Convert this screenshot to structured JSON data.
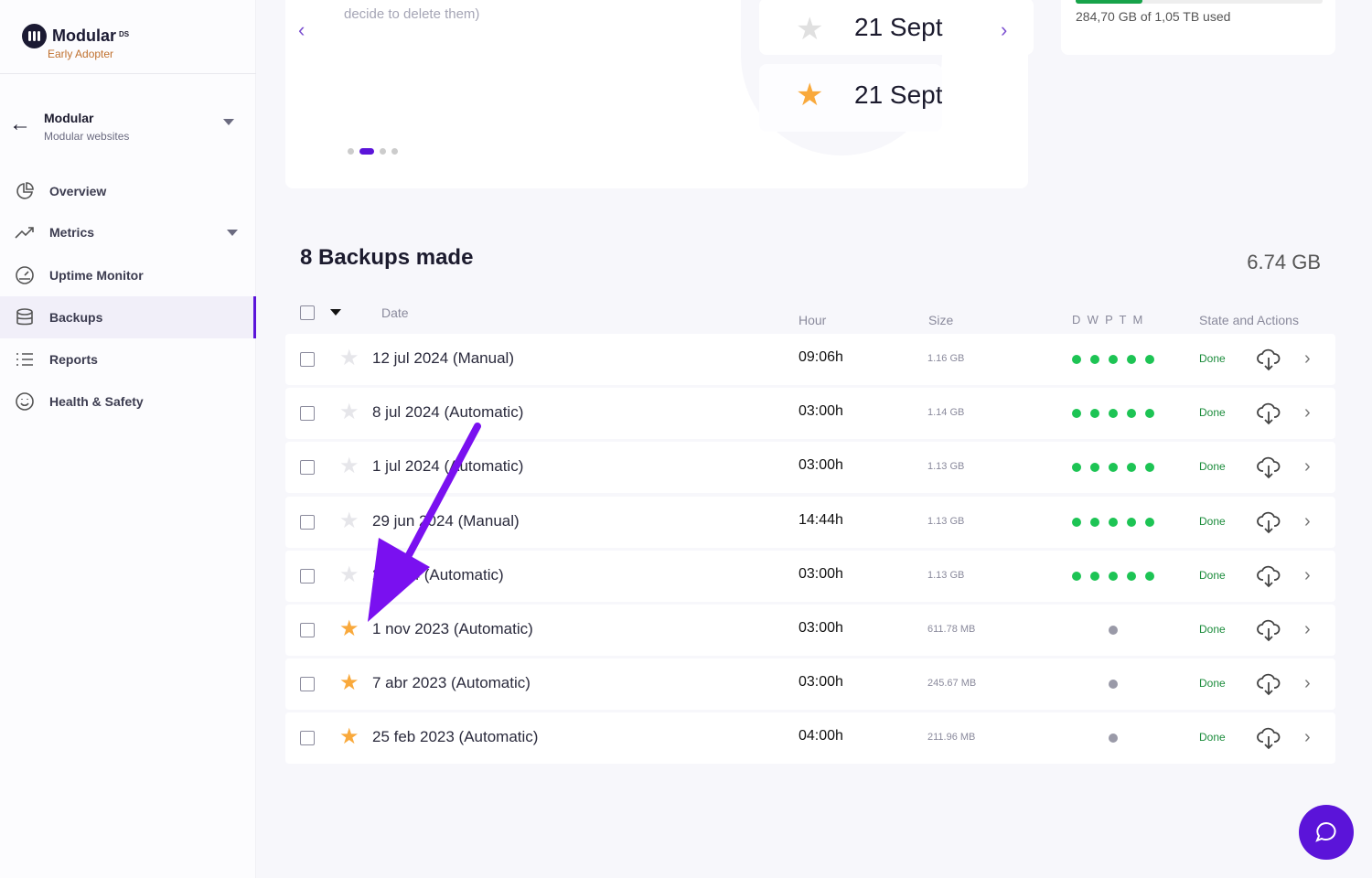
{
  "brand": {
    "name": "Modular",
    "suffix": "DS",
    "tier": "Early Adopter"
  },
  "site": {
    "name": "Modular",
    "subtitle": "Modular websites"
  },
  "nav": [
    {
      "label": "Overview",
      "icon": "pie-chart-icon"
    },
    {
      "label": "Metrics",
      "icon": "trend-icon"
    },
    {
      "label": "Uptime Monitor",
      "icon": "gauge-icon"
    },
    {
      "label": "Backups",
      "icon": "database-icon",
      "active": true
    },
    {
      "label": "Reports",
      "icon": "list-icon"
    },
    {
      "label": "Health & Safety",
      "icon": "smiley-icon"
    }
  ],
  "carousel": {
    "text": "decide to delete them)",
    "active_dot": 1,
    "dots": 4,
    "items": [
      {
        "label": "21 Sept",
        "starred": false
      },
      {
        "label": "21 Sept",
        "starred": true
      }
    ]
  },
  "storage": {
    "text": "284,70 GB of 1,05 TB used",
    "used_percent": 27
  },
  "backups": {
    "title": "8 Backups made",
    "total": "6.74 GB",
    "headers": {
      "date": "Date",
      "hour": "Hour",
      "size": "Size",
      "dwptm": "D  W  P  T  M",
      "state": "State and Actions"
    },
    "rows": [
      {
        "date": "12 jul 2024 (Manual)",
        "hour": "09:06h",
        "size": "1.16 GB",
        "starred": false,
        "full": true,
        "state": "Done"
      },
      {
        "date": "8 jul 2024 (Automatic)",
        "hour": "03:00h",
        "size": "1.14 GB",
        "starred": false,
        "full": true,
        "state": "Done"
      },
      {
        "date": "1 jul 2024 (Automatic)",
        "hour": "03:00h",
        "size": "1.13 GB",
        "starred": false,
        "full": true,
        "state": "Done"
      },
      {
        "date": "29 jun 2024 (Manual)",
        "hour": "14:44h",
        "size": "1.13 GB",
        "starred": false,
        "full": true,
        "state": "Done"
      },
      {
        "date": "2 2024 (Automatic)",
        "hour": "03:00h",
        "size": "1.13 GB",
        "starred": false,
        "full": true,
        "state": "Done"
      },
      {
        "date": "1 nov 2023 (Automatic)",
        "hour": "03:00h",
        "size": "611.78 MB",
        "starred": true,
        "full": false,
        "state": "Done"
      },
      {
        "date": "7 abr 2023 (Automatic)",
        "hour": "03:00h",
        "size": "245.67 MB",
        "starred": true,
        "full": false,
        "state": "Done"
      },
      {
        "date": "25 feb 2023 (Automatic)",
        "hour": "04:00h",
        "size": "211.96 MB",
        "starred": true,
        "full": false,
        "state": "Done"
      }
    ]
  },
  "colors": {
    "accent": "#5b14d9",
    "success": "#1dc454",
    "star": "#f9a93c",
    "annotation_arrow": "#7a10f0"
  }
}
